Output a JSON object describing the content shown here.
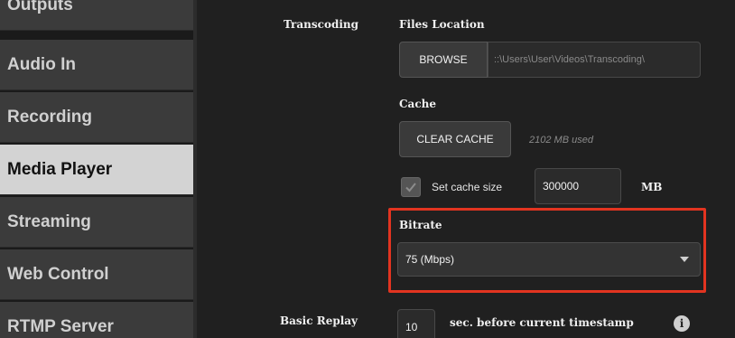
{
  "sidebar": {
    "items": [
      {
        "label": "Outputs"
      },
      {
        "label": "Audio In"
      },
      {
        "label": "Recording"
      },
      {
        "label": "Media Player",
        "active": true
      },
      {
        "label": "Streaming"
      },
      {
        "label": "Web Control"
      },
      {
        "label": "RTMP Server"
      }
    ]
  },
  "transcoding": {
    "section_label": "Transcoding",
    "files_location_label": "Files Location",
    "browse_label": "BROWSE",
    "path_value": "::\\Users\\User\\Videos\\Transcoding\\",
    "cache_label": "Cache",
    "clear_cache_label": "CLEAR CACHE",
    "cache_used": "2102 MB used",
    "set_cache_size_label": "Set cache size",
    "set_cache_checked": true,
    "cache_size_value": "300000",
    "cache_unit": "MB",
    "bitrate_label": "Bitrate",
    "bitrate_selected": "75 (Mbps)"
  },
  "basic_replay": {
    "section_label": "Basic Replay",
    "seconds_value": "10",
    "seconds_label": "sec. before current timestamp",
    "info_glyph": "i"
  },
  "colors": {
    "highlight": "#e23420",
    "active_nav": "#d3d3d3"
  }
}
